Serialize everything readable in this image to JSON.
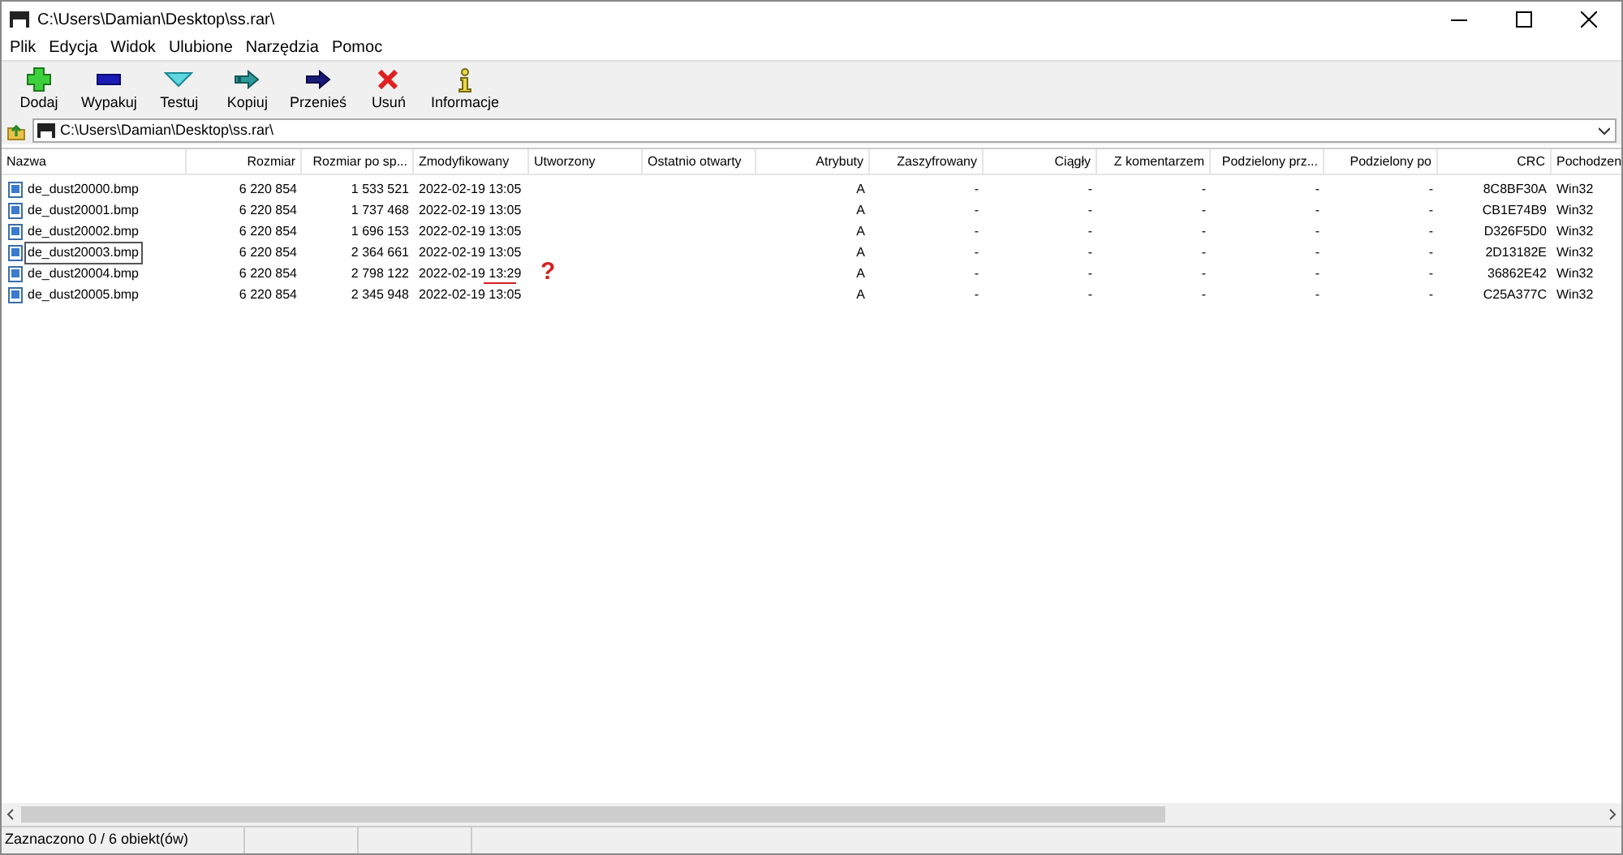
{
  "window": {
    "title": "C:\\Users\\Damian\\Desktop\\ss.rar\\"
  },
  "menu": [
    "Plik",
    "Edycja",
    "Widok",
    "Ulubione",
    "Narzędzia",
    "Pomoc"
  ],
  "toolbar": [
    {
      "kind": "add",
      "label": "Dodaj"
    },
    {
      "kind": "extract",
      "label": "Wypakuj"
    },
    {
      "kind": "test",
      "label": "Testuj"
    },
    {
      "kind": "copy",
      "label": "Kopiuj"
    },
    {
      "kind": "move",
      "label": "Przenieś"
    },
    {
      "kind": "delete",
      "label": "Usuń"
    },
    {
      "kind": "info",
      "label": "Informacje"
    }
  ],
  "address": {
    "value": "C:\\Users\\Damian\\Desktop\\ss.rar\\"
  },
  "table": {
    "columns": [
      {
        "label": "Nazwa"
      },
      {
        "label": "Rozmiar"
      },
      {
        "label": "Rozmiar po sp..."
      },
      {
        "label": "Zmodyfikowany"
      },
      {
        "label": "Utworzony"
      },
      {
        "label": "Ostatnio otwarty"
      },
      {
        "label": "Atrybuty"
      },
      {
        "label": "Zaszyfrowany"
      },
      {
        "label": "Ciągły"
      },
      {
        "label": "Z komentarzem"
      },
      {
        "label": "Podzielony prz..."
      },
      {
        "label": "Podzielony po"
      },
      {
        "label": "CRC"
      },
      {
        "label": "Pochodzen"
      }
    ],
    "rows": [
      {
        "focused": false,
        "cells": [
          "de_dust20000.bmp",
          "6 220 854",
          "1 533 521",
          "2022-02-19 13:05",
          null,
          null,
          "A",
          "-",
          "-",
          "-",
          "-",
          "-",
          "8C8BF30A",
          "Win32"
        ]
      },
      {
        "focused": false,
        "cells": [
          "de_dust20001.bmp",
          "6 220 854",
          "1 737 468",
          "2022-02-19 13:05",
          null,
          null,
          "A",
          "-",
          "-",
          "-",
          "-",
          "-",
          "CB1E74B9",
          "Win32"
        ]
      },
      {
        "focused": false,
        "cells": [
          "de_dust20002.bmp",
          "6 220 854",
          "1 696 153",
          "2022-02-19 13:05",
          null,
          null,
          "A",
          "-",
          "-",
          "-",
          "-",
          "-",
          "D326F5D0",
          "Win32"
        ]
      },
      {
        "focused": true,
        "cells": [
          "de_dust20003.bmp",
          "6 220 854",
          "2 364 661",
          "2022-02-19 13:05",
          null,
          null,
          "A",
          "-",
          "-",
          "-",
          "-",
          "-",
          "2D13182E",
          "Win32"
        ]
      },
      {
        "focused": false,
        "annotated": true,
        "cells": [
          "de_dust20004.bmp",
          "6 220 854",
          "2 798 122",
          "2022-02-19 13:29",
          null,
          null,
          "A",
          "-",
          "-",
          "-",
          "-",
          "-",
          "36862E42",
          "Win32"
        ]
      },
      {
        "focused": false,
        "cells": [
          "de_dust20005.bmp",
          "6 220 854",
          "2 345 948",
          "2022-02-19 13:05",
          null,
          null,
          "A",
          "-",
          "-",
          "-",
          "-",
          "-",
          "C25A377C",
          "Win32"
        ]
      }
    ]
  },
  "annotation": {
    "mark": "?"
  },
  "status_bar": {
    "text": "Zaznaczono 0 / 6 obiekt(ów)"
  }
}
